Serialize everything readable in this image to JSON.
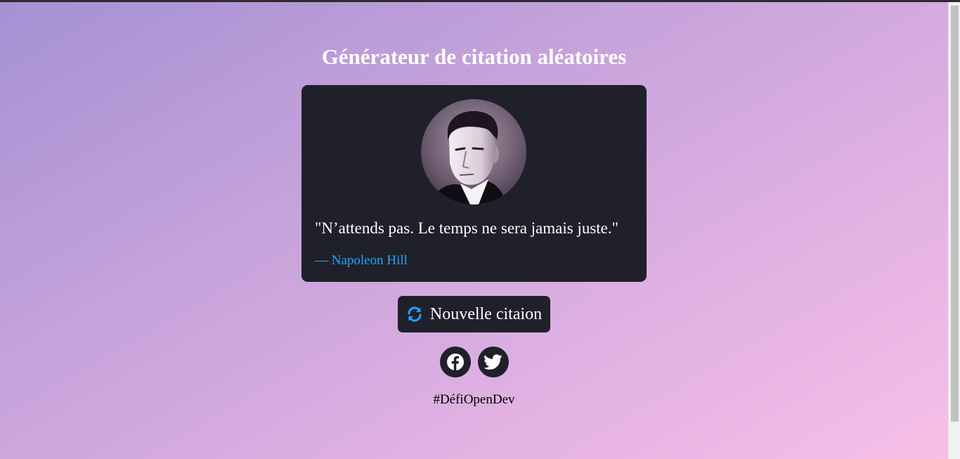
{
  "page": {
    "title": "Générateur de citation aléatoires",
    "hashtag": "#DéfiOpenDev"
  },
  "quote_card": {
    "avatar_icon": "author-portrait",
    "quote_text": "\"N’attends pas. Le temps ne sera jamais juste.\"",
    "author": "— Napoleon Hill"
  },
  "actions": {
    "new_quote_label": "Nouvelle citaion",
    "new_quote_icon": "sync-icon"
  },
  "social": {
    "facebook_icon": "facebook-icon",
    "twitter_icon": "twitter-icon"
  },
  "colors": {
    "card_bg": "#20202b",
    "accent": "#1ea7ff",
    "gradient_start": "#a591d3",
    "gradient_end": "#f7c0e7"
  }
}
